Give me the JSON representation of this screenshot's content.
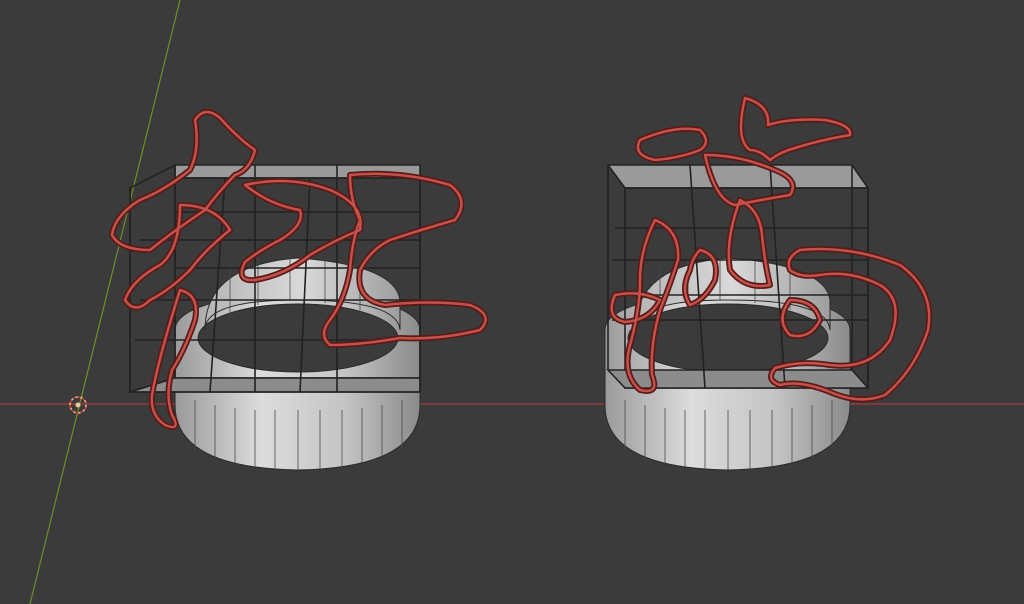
{
  "viewport": {
    "background_color": "#3b3b3b",
    "view": "perspective"
  },
  "axes": {
    "x_axis_color": "#a8393c",
    "y_axis_color": "#6f8f2a"
  },
  "world_origin": {
    "icon": "crosshair-origin-icon",
    "color": "#e8c9a0"
  },
  "objects": [
    {
      "id": "left-ring",
      "body_color": "#c9c9c9",
      "wire_color": "#2a2a2a",
      "grid_cells": "3x3",
      "selected": true,
      "outline_color": "#b8423e"
    },
    {
      "id": "right-ring",
      "body_color": "#c9c9c9",
      "wire_color": "#2a2a2a",
      "grid_cells": "3x3",
      "selected": true,
      "outline_color": "#b8423e"
    }
  ]
}
